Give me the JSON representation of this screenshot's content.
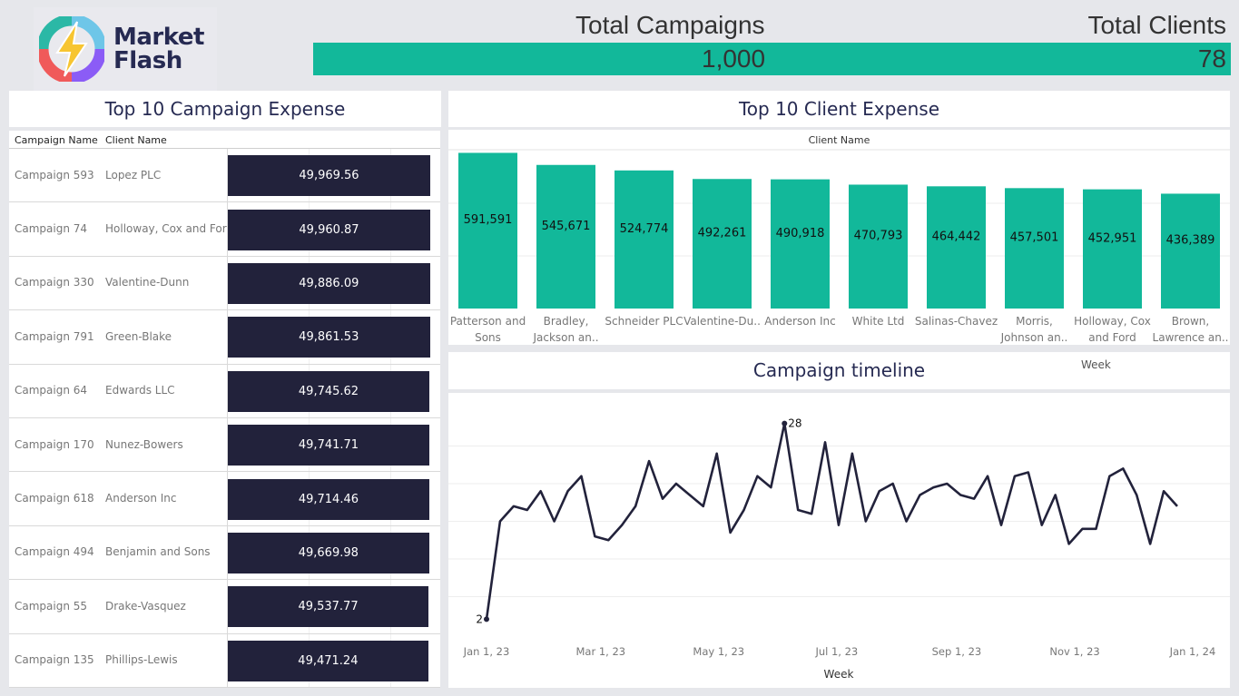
{
  "logo": {
    "line1": "Market",
    "line2": "Flash"
  },
  "kpis": {
    "campaigns": {
      "label": "Total Campaigns",
      "value": "1,000"
    },
    "clients": {
      "label": "Total Clients",
      "value": "78"
    },
    "bar_color": "#12b89a"
  },
  "campaign_panel": {
    "title": "Top 10 Campaign Expense",
    "col_campaign": "Campaign Name",
    "col_client": "Client Name",
    "rows": [
      {
        "campaign": "Campaign 593",
        "client": "Lopez PLC",
        "value_label": "49,969.56",
        "value": 49969.56
      },
      {
        "campaign": "Campaign 74",
        "client": "Holloway, Cox and Ford",
        "value_label": "49,960.87",
        "value": 49960.87
      },
      {
        "campaign": "Campaign 330",
        "client": "Valentine-Dunn",
        "value_label": "49,886.09",
        "value": 49886.09
      },
      {
        "campaign": "Campaign 791",
        "client": "Green-Blake",
        "value_label": "49,861.53",
        "value": 49861.53
      },
      {
        "campaign": "Campaign 64",
        "client": "Edwards LLC",
        "value_label": "49,745.62",
        "value": 49745.62
      },
      {
        "campaign": "Campaign 170",
        "client": "Nunez-Bowers",
        "value_label": "49,741.71",
        "value": 49741.71
      },
      {
        "campaign": "Campaign 618",
        "client": "Anderson Inc",
        "value_label": "49,714.46",
        "value": 49714.46
      },
      {
        "campaign": "Campaign 494",
        "client": "Benjamin and Sons",
        "value_label": "49,669.98",
        "value": 49669.98
      },
      {
        "campaign": "Campaign 55",
        "client": "Drake-Vasquez",
        "value_label": "49,537.77",
        "value": 49537.77
      },
      {
        "campaign": "Campaign 135",
        "client": "Phillips-Lewis",
        "value_label": "49,471.24",
        "value": 49471.24
      }
    ],
    "bar_color": "#22223b"
  },
  "chart_data": [
    {
      "type": "bar",
      "title": "Top 10 Client Expense",
      "xlabel": "Client Name",
      "categories": [
        [
          "Patterson and",
          "Sons"
        ],
        [
          "Bradley,",
          "Jackson an.."
        ],
        [
          "Schneider PLC"
        ],
        [
          "Valentine-Du.."
        ],
        [
          "Anderson Inc"
        ],
        [
          "White Ltd"
        ],
        [
          "Salinas-Chavez"
        ],
        [
          "Morris,",
          "Johnson an.."
        ],
        [
          "Holloway, Cox",
          "and Ford"
        ],
        [
          "Brown,",
          "Lawrence an.."
        ]
      ],
      "values": [
        591591,
        545671,
        524774,
        492261,
        490918,
        470793,
        464442,
        457501,
        452951,
        436389
      ],
      "value_labels": [
        "591,591",
        "545,671",
        "524,774",
        "492,261",
        "490,918",
        "470,793",
        "464,442",
        "457,501",
        "452,951",
        "436,389"
      ],
      "ylim": [
        0,
        600000
      ],
      "grid": true,
      "color": "#12b89a"
    },
    {
      "type": "line",
      "title": "Campaign timeline",
      "legend_title": "Week",
      "xlabel": "Week",
      "x_ticks": [
        "Jan 1, 23",
        "Mar 1, 23",
        "May 1, 23",
        "Jul 1, 23",
        "Sep 1, 23",
        "Nov 1, 23",
        "Jan 1, 24"
      ],
      "x_tick_weeks": [
        0,
        8.43,
        17.14,
        25.86,
        34.71,
        43.43,
        52.14
      ],
      "weeks": [
        0,
        1,
        2,
        3,
        4,
        5,
        6,
        7,
        8,
        9,
        10,
        11,
        12,
        13,
        14,
        15,
        16,
        17,
        18,
        19,
        20,
        21,
        22,
        23,
        24,
        25,
        26,
        27,
        28,
        29,
        30,
        31,
        32,
        33,
        34,
        35,
        36,
        37,
        38,
        39,
        40,
        41,
        42,
        43,
        44,
        45,
        46,
        47,
        48,
        49,
        50,
        51
      ],
      "values": [
        2,
        15,
        17,
        16.5,
        19,
        15,
        19,
        21,
        13,
        12.5,
        14.5,
        17,
        23,
        18,
        20,
        18.5,
        17,
        24,
        13.5,
        16.5,
        21,
        19.5,
        28,
        16.5,
        16,
        25.5,
        14.5,
        24,
        15,
        19,
        20,
        15,
        18.5,
        19.5,
        20,
        18.5,
        18,
        21,
        14.5,
        21,
        21.5,
        14.5,
        18.5,
        12,
        14,
        14,
        21,
        22,
        18.5,
        12,
        19,
        17
      ],
      "point_labels": [
        {
          "week": 0,
          "label": "2"
        },
        {
          "week": 22,
          "label": "28"
        }
      ],
      "ylim": [
        0,
        30
      ],
      "grid": true,
      "color": "#22223b"
    }
  ]
}
